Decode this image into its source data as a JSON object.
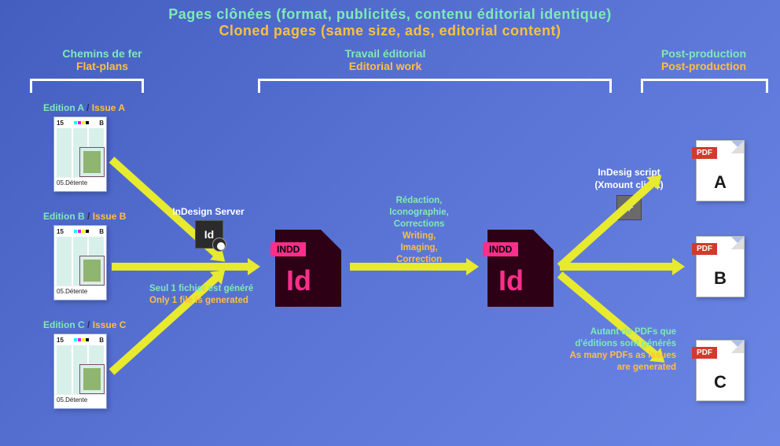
{
  "title": {
    "fr": "Pages clônées (format, publicités, contenu éditorial identique)",
    "en": "Cloned pages (same size, ads, editorial content)"
  },
  "sections": {
    "flatplans": {
      "fr": "Chemins de fer",
      "en": "Flat-plans"
    },
    "editorial": {
      "fr": "Travail éditorial",
      "en": "Editorial work"
    },
    "post": {
      "fr": "Post-production",
      "en": "Post-production"
    }
  },
  "flatplans": [
    {
      "fr": "Edition A",
      "en": "Issue A",
      "page_num": "15",
      "corner": "B",
      "footer": "05.Détente"
    },
    {
      "fr": "Edition B",
      "en": "Issue B",
      "page_num": "15",
      "corner": "B",
      "footer": "05.Détente"
    },
    {
      "fr": "Edition C",
      "en": "Issue C",
      "page_num": "15",
      "corner": "B",
      "footer": "05.Détente"
    }
  ],
  "indesign_server": {
    "label": "InDesign Server",
    "icon_text": "Id"
  },
  "single_file_note": {
    "fr": "Seul 1 fichier est généré",
    "en": "Only 1 file is generated"
  },
  "indd_tag": "INDD",
  "indd_id": "Id",
  "editorial_note": {
    "fr1": "Rédaction,",
    "fr2": "Iconographie,",
    "fr3": "Corrections",
    "en1": "Writing,",
    "en2": "Imaging,",
    "en3": "Correction"
  },
  "script": {
    "line1": "InDesig script",
    "line2": "(Xmount client)",
    "glyph": "✦"
  },
  "pdf_note": {
    "fr1": "Autant de PDFs que",
    "fr2": "d'éditions sont générés",
    "en1": "As many PDFs as issues",
    "en2": "are generated"
  },
  "pdfs": [
    {
      "badge": "PDF",
      "letter": "A"
    },
    {
      "badge": "PDF",
      "letter": "B"
    },
    {
      "badge": "PDF",
      "letter": "C"
    }
  ]
}
